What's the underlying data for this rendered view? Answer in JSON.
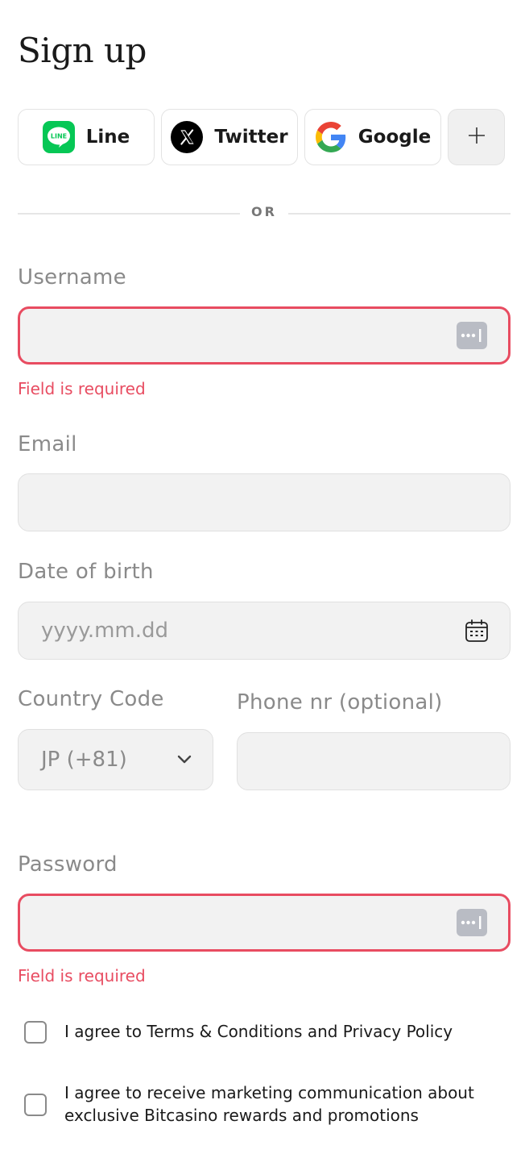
{
  "page": {
    "title": "Sign up"
  },
  "social": {
    "line_label": "Line",
    "line_logo_text": "LINE",
    "twitter_label": "Twitter",
    "google_label": "Google",
    "more_icon": "plus-icon"
  },
  "divider": {
    "label": "OR"
  },
  "form": {
    "username": {
      "label": "Username",
      "value": "",
      "error": "Field is required"
    },
    "email": {
      "label": "Email",
      "value": ""
    },
    "dob": {
      "label": "Date of birth",
      "placeholder": "yyyy.mm.dd"
    },
    "country_code": {
      "label": "Country Code",
      "value": "JP (+81)"
    },
    "phone": {
      "label": "Phone nr (optional)",
      "value": ""
    },
    "password": {
      "label": "Password",
      "value": "",
      "error": "Field is required"
    }
  },
  "consents": {
    "terms": "I agree to Terms & Conditions and Privacy Policy",
    "marketing_line1": "I agree to receive marketing communication about",
    "marketing_line2": "exclusive Bitcasino rewards and promotions"
  },
  "colors": {
    "error": "#e84c61",
    "field_bg": "#f2f2f2",
    "line_green": "#06c755"
  }
}
